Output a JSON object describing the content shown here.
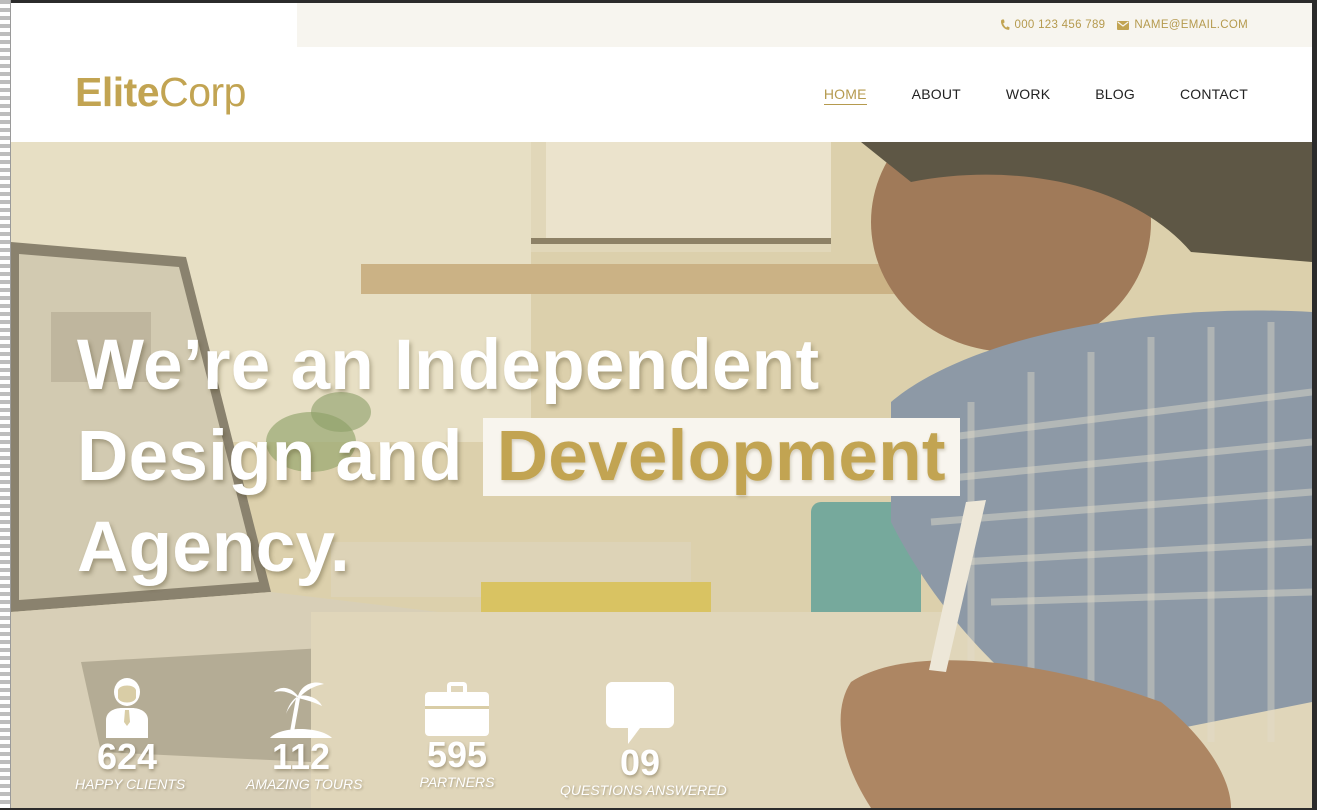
{
  "topbar": {
    "phone": "000 123 456 789",
    "email": "NAME@EMAIL.COM",
    "phone_icon": "phone-icon",
    "email_icon": "envelope-icon"
  },
  "brand": {
    "name_bold": "Elite",
    "name_light": "Corp"
  },
  "nav": {
    "items": [
      {
        "label": "HOME",
        "active": true
      },
      {
        "label": "ABOUT",
        "active": false
      },
      {
        "label": "WORK",
        "active": false
      },
      {
        "label": "BLOG",
        "active": false
      },
      {
        "label": "CONTACT",
        "active": false
      }
    ]
  },
  "hero": {
    "line1": "We’re an Independent",
    "line2_prefix": "Design and",
    "line2_highlight": "Development",
    "line3": "Agency."
  },
  "stats": [
    {
      "number": "624",
      "label": "HAPPY CLIENTS",
      "icon": "client-icon"
    },
    {
      "number": "112",
      "label": "AMAZING TOURS",
      "icon": "island-icon"
    },
    {
      "number": "595",
      "label": "PARTNERS",
      "icon": "briefcase-icon"
    },
    {
      "number": "09",
      "label": "QUESTIONS ANSWERED",
      "icon": "chat-bubble-icon"
    }
  ],
  "colors": {
    "accent": "#c2a452",
    "topbar_bg": "#f7f5ef",
    "text_dark": "#222222"
  }
}
